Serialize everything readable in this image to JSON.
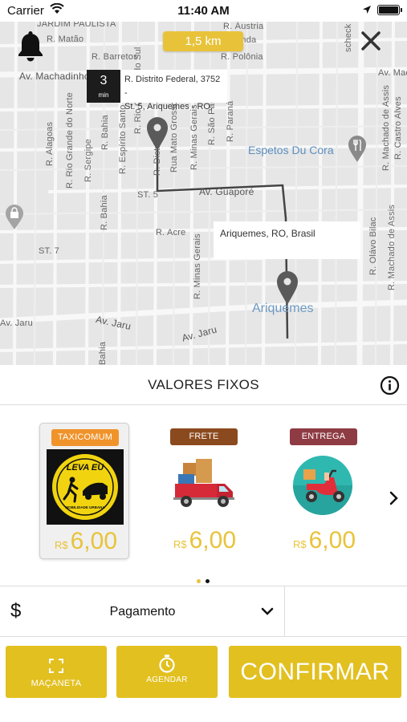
{
  "status_bar": {
    "carrier": "Carrier",
    "time": "11:40 AM"
  },
  "map": {
    "distance_label": "1,5 km",
    "eta": {
      "value": "3",
      "unit": "min"
    },
    "origin_address": [
      "R. Distrito Federal, 3752 -",
      "St. 5, Ariquemes - RO,"
    ],
    "destination_address": "Ariquemes, RO, Brasil",
    "streets": {
      "jardim_paulista": "JARDIM PAULISTA",
      "matao": "R. Matão",
      "austria": "R. Áustria",
      "holanda": "Holanda",
      "barretos": "R. Barretos",
      "polonia": "R. Polônia",
      "machadinho": "Av. Machadinho",
      "machadinho_right": "Av. Machadinho",
      "alagoas": "R. Alagoas",
      "rio_grande_norte": "R. Rio Grande do Norte",
      "sergipe": "R. Sergipe",
      "bahia": "R. Bahia",
      "espirito_santo": "R. Espírito Santo",
      "rio_grande_sul": "R. Rio Grande do Sul",
      "distrito": "R. Distrito",
      "mato_grosso": "Rua Mato Grosso",
      "minas_gerais": "R. Minas Gerais",
      "sao_paulo": "R. São Paulo",
      "parana": "R. Paraná",
      "castro_alves": "R. Castro Alves",
      "machado_assis": "R. Machado de Assis",
      "machado_assis_2": "R. Machado de Assis",
      "olavo_bilac": "R. Olávo Bilac",
      "st5": "ST. 5",
      "guapore": "Av. Guaporé",
      "bahia_2": "R. Bahia",
      "acre": "R. Acre",
      "st7": "ST. 7",
      "minas_gerais_2": "R. Minas Gerais",
      "jaru": "Av. Jaru",
      "jaru_2": "Av. Jaru",
      "jaru_3": "Av. Jaru",
      "schek": "scheck",
      "bahia_3": "Bahia"
    },
    "pois": {
      "restaurant": "Espetos Du Cora",
      "city": "Ariquemes"
    }
  },
  "section": {
    "title": "VALORES FIXOS"
  },
  "services": [
    {
      "badge": "TAXICOMUM",
      "badge_color": "#f0932b",
      "currency": "R$",
      "price": "6,00",
      "logo_top": "LEVA EU",
      "logo_bottom": "MOBILIDADE URBANA",
      "selected": true
    },
    {
      "badge": "FRETE",
      "badge_color": "#8b4a1e",
      "currency": "R$",
      "price": "6,00",
      "selected": false
    },
    {
      "badge": "ENTREGA",
      "badge_color": "#8e3b43",
      "currency": "R$",
      "price": "6,00",
      "selected": false
    }
  ],
  "pagination": {
    "pages": 2,
    "active": 0
  },
  "payment": {
    "label": "Pagamento",
    "symbol": "$"
  },
  "actions": {
    "handle": "MAÇANETA",
    "schedule": "AGENDAR",
    "confirm": "CONFIRMAR"
  },
  "colors": {
    "accent": "#e2c020",
    "price": "#e8c33a",
    "route": "#444444"
  }
}
